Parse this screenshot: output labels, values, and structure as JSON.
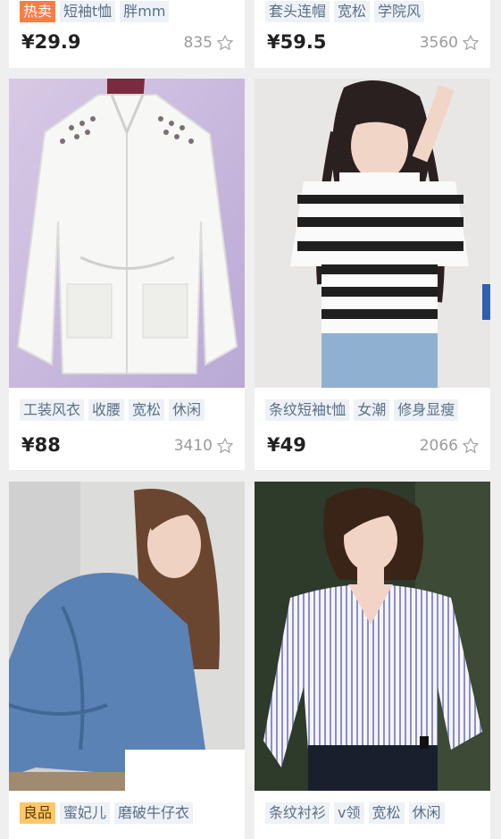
{
  "products": [
    {
      "tags": [
        {
          "text": "热卖",
          "type": "hot"
        },
        {
          "text": "短袖t恤"
        },
        {
          "text": "胖mm"
        }
      ],
      "price": "¥29.9",
      "count": "835"
    },
    {
      "tags": [
        {
          "text": "套头连帽"
        },
        {
          "text": "宽松"
        },
        {
          "text": "学院风"
        }
      ],
      "price": "¥59.5",
      "count": "3560"
    },
    {
      "tags": [
        {
          "text": "工装风衣"
        },
        {
          "text": "收腰"
        },
        {
          "text": "宽松"
        },
        {
          "text": "休闲"
        }
      ],
      "price": "¥88",
      "count": "3410"
    },
    {
      "tags": [
        {
          "text": "条纹短袖t恤"
        },
        {
          "text": "女潮"
        },
        {
          "text": "修身显瘦"
        }
      ],
      "price": "¥49",
      "count": "2066"
    },
    {
      "tags": [
        {
          "text": "良品",
          "type": "good"
        },
        {
          "text": "蜜妃儿"
        },
        {
          "text": "磨破牛仔衣"
        }
      ]
    },
    {
      "tags": [
        {
          "text": "条纹衬衫"
        },
        {
          "text": "v领"
        },
        {
          "text": "宽松"
        },
        {
          "text": "休闲"
        }
      ]
    }
  ],
  "colors": {
    "hot_tag": "#ff7b45",
    "good_tag": "#ffc768",
    "tag_bg": "#eef2f6",
    "tag_text": "#5a6f86"
  }
}
